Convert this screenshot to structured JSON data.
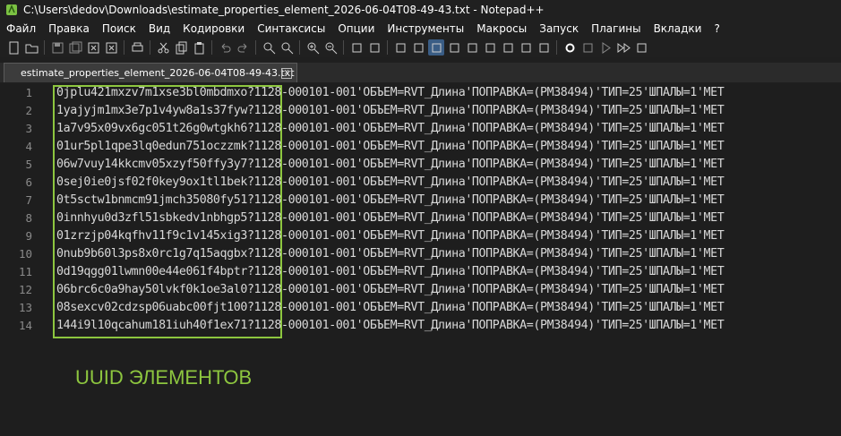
{
  "window": {
    "title": "C:\\Users\\dedov\\Downloads\\estimate_properties_element_2026-06-04T08-49-43.txt - Notepad++"
  },
  "menu": [
    "Файл",
    "Правка",
    "Поиск",
    "Вид",
    "Кодировки",
    "Синтаксисы",
    "Опции",
    "Инструменты",
    "Макросы",
    "Запуск",
    "Плагины",
    "Вкладки",
    "?"
  ],
  "toolbar_icons": [
    "new-file-icon",
    "open-file-icon",
    "save-icon",
    "save-all-icon",
    "close-icon",
    "close-all-icon",
    "print-icon",
    "cut-icon",
    "copy-icon",
    "paste-icon",
    "undo-icon",
    "redo-icon",
    "find-icon",
    "replace-icon",
    "zoom-in-icon",
    "zoom-out-icon",
    "sync-vertical-icon",
    "sync-horizontal-icon",
    "word-wrap-icon",
    "show-all-chars-icon",
    "indent-guide-icon",
    "xml-tag-icon",
    "document-map-icon",
    "folder-workspace-icon",
    "function-list-icon",
    "monitoring-icon",
    "screenshot-icon",
    "record-macro-icon",
    "stop-macro-icon",
    "play-macro-icon",
    "run-macro-multiple-icon",
    "save-macro-icon"
  ],
  "tab": {
    "label": "estimate_properties_element_2026-06-04T08-49-43.txt",
    "close": "x"
  },
  "lines": [
    {
      "num": "1",
      "text": "0jplu421mxzv7m1xse3bl0mbdmxo?1128-000101-001'ОБЪЕМ=RVT_Длина'ПОПРАВКА=(РМ38494)'ТИП=25'ШПАЛЫ=1'МЕТ"
    },
    {
      "num": "2",
      "text": "1yajyjm1mx3e7p1v4yw8a1s37fyw?1128-000101-001'ОБЪЕМ=RVT_Длина'ПОПРАВКА=(РМ38494)'ТИП=25'ШПАЛЫ=1'МЕТ"
    },
    {
      "num": "3",
      "text": "1a7v95x09vx6gc051t26g0wtgkh6?1128-000101-001'ОБЪЕМ=RVT_Длина'ПОПРАВКА=(РМ38494)'ТИП=25'ШПАЛЫ=1'МЕТ"
    },
    {
      "num": "4",
      "text": "01ur5pl1qpe3lq0edun751oczzmk?1128-000101-001'ОБЪЕМ=RVT_Длина'ПОПРАВКА=(РМ38494)'ТИП=25'ШПАЛЫ=1'МЕТ"
    },
    {
      "num": "5",
      "text": "06w7vuy14kkcmv05xzyf50ffy3y7?1128-000101-001'ОБЪЕМ=RVT_Длина'ПОПРАВКА=(РМ38494)'ТИП=25'ШПАЛЫ=1'МЕТ"
    },
    {
      "num": "6",
      "text": "0sej0ie0jsf02f0key9ox1tl1bek?1128-000101-001'ОБЪЕМ=RVT_Длина'ПОПРАВКА=(РМ38494)'ТИП=25'ШПАЛЫ=1'МЕТ"
    },
    {
      "num": "7",
      "text": "0t5sctw1bnmcm91jmch35080fy51?1128-000101-001'ОБЪЕМ=RVT_Длина'ПОПРАВКА=(РМ38494)'ТИП=25'ШПАЛЫ=1'МЕТ"
    },
    {
      "num": "8",
      "text": "0innhyu0d3zfl51sbkedv1nbhgp5?1128-000101-001'ОБЪЕМ=RVT_Длина'ПОПРАВКА=(РМ38494)'ТИП=25'ШПАЛЫ=1'МЕТ"
    },
    {
      "num": "9",
      "text": "01zrzjp04kqfhv11f9c1v145xig3?1128-000101-001'ОБЪЕМ=RVT_Длина'ПОПРАВКА=(РМ38494)'ТИП=25'ШПАЛЫ=1'МЕТ"
    },
    {
      "num": "10",
      "text": "0nub9b60l3ps8x0rc1g7q15aqgbx?1128-000101-001'ОБЪЕМ=RVT_Длина'ПОПРАВКА=(РМ38494)'ТИП=25'ШПАЛЫ=1'МЕТ"
    },
    {
      "num": "11",
      "text": "0d19qgg01lwmn00e44e061f4bptr?1128-000101-001'ОБЪЕМ=RVT_Длина'ПОПРАВКА=(РМ38494)'ТИП=25'ШПАЛЫ=1'МЕТ"
    },
    {
      "num": "12",
      "text": "06brc6c0a9hay50lvkf0k1oe3al0?1128-000101-001'ОБЪЕМ=RVT_Длина'ПОПРАВКА=(РМ38494)'ТИП=25'ШПАЛЫ=1'МЕТ"
    },
    {
      "num": "13",
      "text": "08sexcv02cdzsp06uabc00fjt100?1128-000101-001'ОБЪЕМ=RVT_Длина'ПОПРАВКА=(РМ38494)'ТИП=25'ШПАЛЫ=1'МЕТ"
    },
    {
      "num": "14",
      "text": "144i9l10qcahum181iuh40f1ex71?1128-000101-001'ОБЪЕМ=RVT_Длина'ПОПРАВКА=(РМ38494)'ТИП=25'ШПАЛЫ=1'МЕТ"
    }
  ],
  "annotation": "UUID ЭЛЕМЕНТОВ",
  "colors": {
    "background": "#1e1e1e",
    "highlight": "#8dc63f",
    "text": "#d8d8d8",
    "line_numbers": "#8a8a8a"
  }
}
